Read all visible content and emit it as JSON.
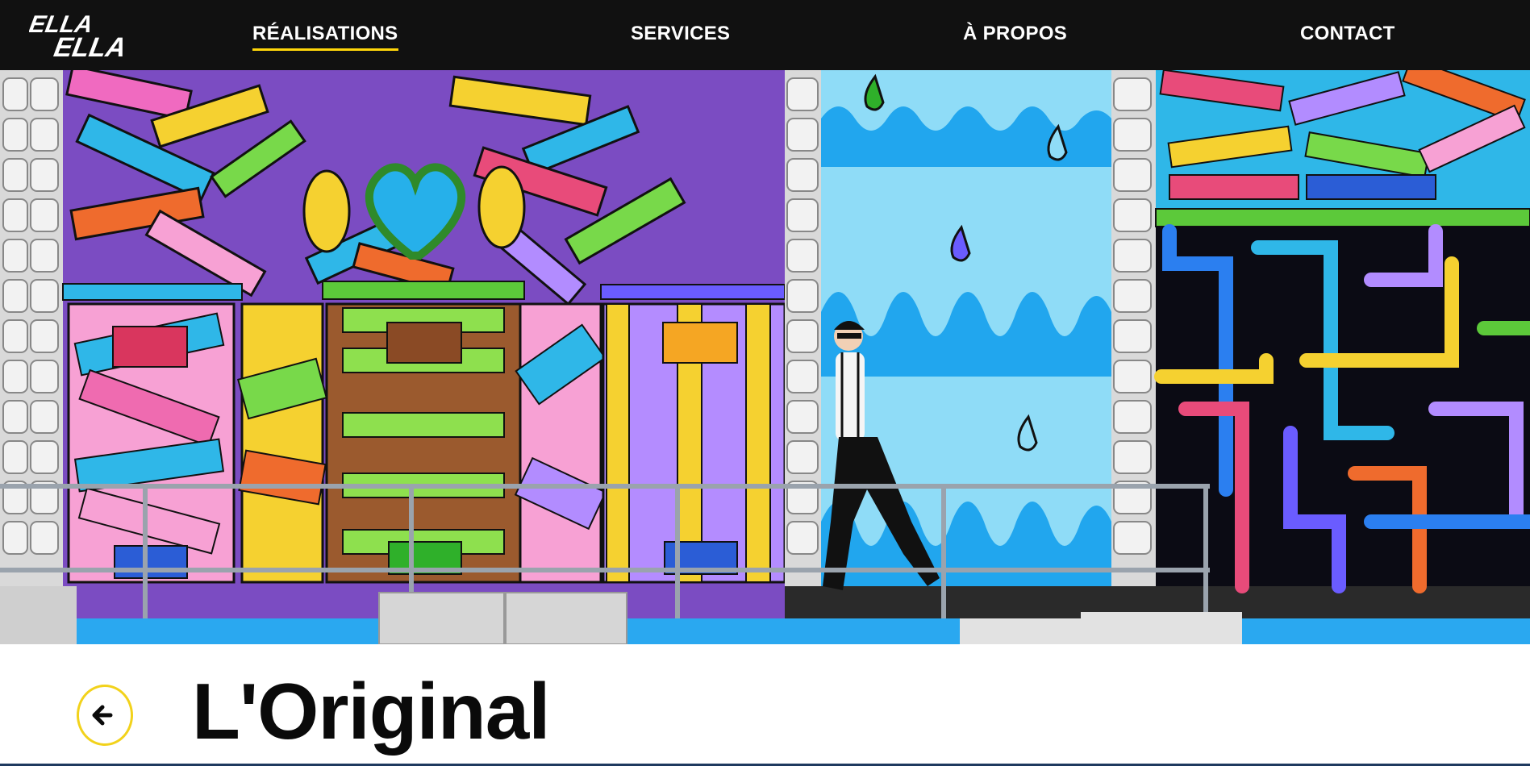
{
  "brand": {
    "logo_line1": "ELLA",
    "logo_line2": "ELLA"
  },
  "nav": {
    "items": [
      {
        "label": "RÉALISATIONS",
        "active": true
      },
      {
        "label": "SERVICES",
        "active": false
      },
      {
        "label": "À PROPOS",
        "active": false
      },
      {
        "label": "CONTACT",
        "active": false
      }
    ]
  },
  "hero": {
    "image_icon": "mural-photo"
  },
  "page": {
    "title": "L'Original",
    "back_icon": "arrow-left-icon"
  },
  "colors": {
    "nav_bg": "#111111",
    "accent": "#ffd60a",
    "back_ring": "#f2d21b",
    "title": "#0a0a0a"
  }
}
